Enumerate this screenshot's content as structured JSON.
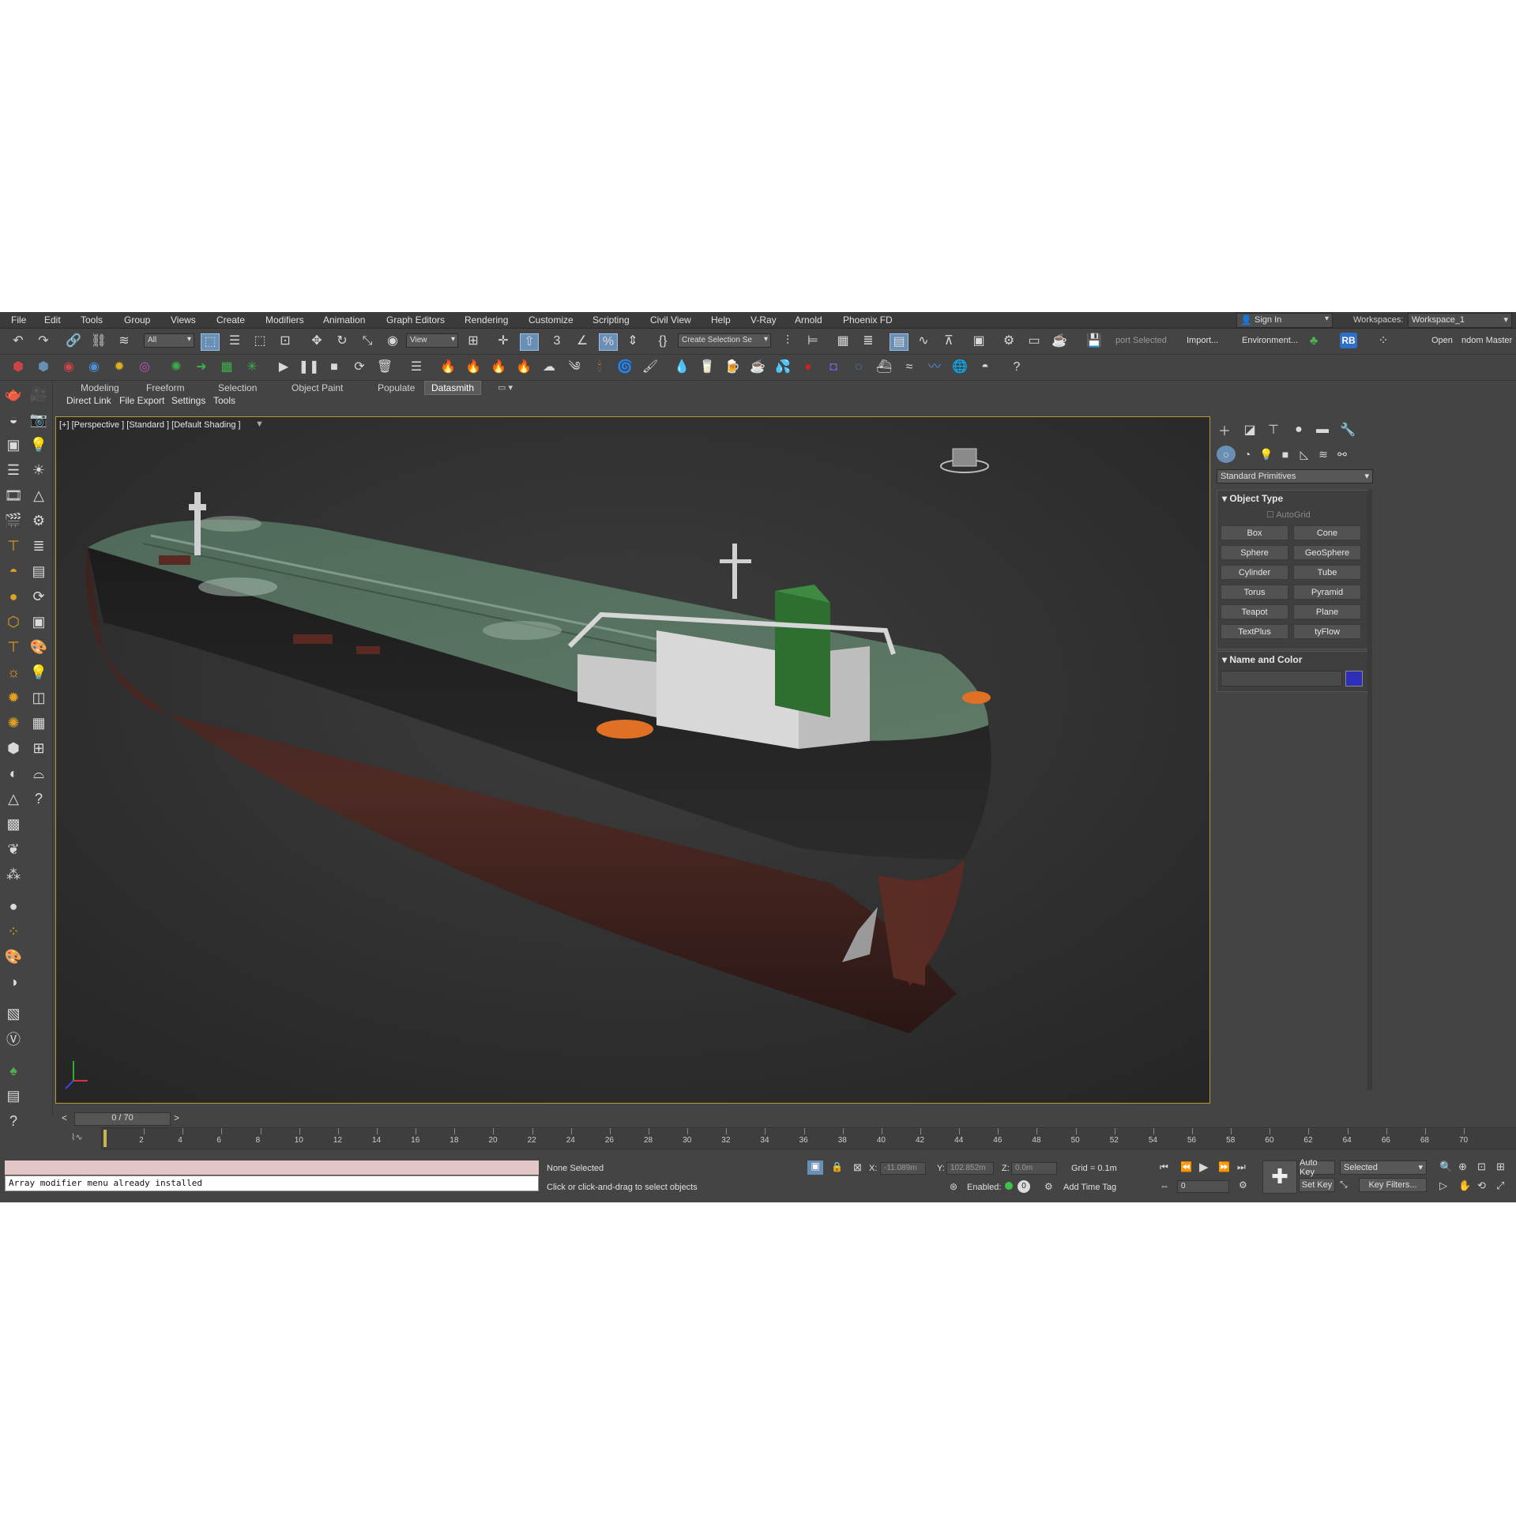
{
  "menubar": {
    "items": [
      {
        "label": "File"
      },
      {
        "label": "Edit"
      },
      {
        "label": "Tools"
      },
      {
        "label": "Group"
      },
      {
        "label": "Views"
      },
      {
        "label": "Create"
      },
      {
        "label": "Modifiers"
      },
      {
        "label": "Animation"
      },
      {
        "label": "Graph Editors"
      },
      {
        "label": "Rendering"
      },
      {
        "label": "Customize"
      },
      {
        "label": "Scripting"
      },
      {
        "label": "Civil View"
      },
      {
        "label": "Help"
      },
      {
        "label": "V-Ray"
      },
      {
        "label": "Arnold"
      },
      {
        "label": "Phoenix FD"
      }
    ],
    "signin": "Sign In",
    "workspaces_label": "Workspaces:",
    "workspace_value": "Workspace_1"
  },
  "toolbar": {
    "selection_filter": "All",
    "ref_coord": "View",
    "named_selection": "Create Selection Se",
    "export_selected": "port Selected",
    "import": "Import...",
    "environment": "Environment...",
    "rb_badge": "RB",
    "open": "Open",
    "random_master": "ndom Master",
    "accent": "#6a8fb5"
  },
  "ribbon": {
    "tabs": [
      {
        "label": "Modeling"
      },
      {
        "label": "Freeform"
      },
      {
        "label": "Selection"
      },
      {
        "label": "Object Paint"
      },
      {
        "label": "Populate"
      },
      {
        "label": "Datasmith"
      }
    ],
    "active_tab": "Datasmith",
    "subtabs": [
      {
        "label": "Direct Link"
      },
      {
        "label": "File Export"
      },
      {
        "label": "Settings"
      },
      {
        "label": "Tools"
      }
    ]
  },
  "viewport": {
    "label": "[+] [Perspective ] [Standard ] [Default Shading ]",
    "border_color": "#b39b3c"
  },
  "command_panel": {
    "category": "Standard Primitives",
    "object_type": {
      "title": "Object Type",
      "autogrid": "AutoGrid",
      "buttons": [
        {
          "label": "Box"
        },
        {
          "label": "Cone"
        },
        {
          "label": "Sphere"
        },
        {
          "label": "GeoSphere"
        },
        {
          "label": "Cylinder"
        },
        {
          "label": "Tube"
        },
        {
          "label": "Torus"
        },
        {
          "label": "Pyramid"
        },
        {
          "label": "Teapot"
        },
        {
          "label": "Plane"
        },
        {
          "label": "TextPlus"
        },
        {
          "label": "tyFlow"
        }
      ]
    },
    "name_color": {
      "title": "Name and Color",
      "swatch": "#2e2fb8"
    }
  },
  "timeline": {
    "frame_display": "0 / 70",
    "ticks": [
      "2",
      "4",
      "6",
      "8",
      "10",
      "12",
      "14",
      "16",
      "18",
      "20",
      "22",
      "24",
      "26",
      "28",
      "30",
      "32",
      "34",
      "36",
      "38",
      "40",
      "42",
      "44",
      "46",
      "48",
      "50",
      "52",
      "54",
      "56",
      "58",
      "60",
      "62",
      "64",
      "66",
      "68",
      "70"
    ]
  },
  "statusbar": {
    "maxscript_output": "Array modifier menu already installed",
    "selection_status": "None Selected",
    "prompt": "Click or click-and-drag to select objects",
    "x_label": "X:",
    "x_value": "-11.089m",
    "y_label": "Y:",
    "y_value": "102.852m",
    "z_label": "Z:",
    "z_value": "0.0m",
    "grid": "Grid = 0.1m",
    "enabled_label": "Enabled:",
    "enabled_value": "0",
    "add_time_tag": "Add Time Tag",
    "auto_key": "Auto Key",
    "set_key": "Set Key",
    "key_mode": "Selected",
    "key_filters": "Key Filters...",
    "current_frame": "0"
  }
}
